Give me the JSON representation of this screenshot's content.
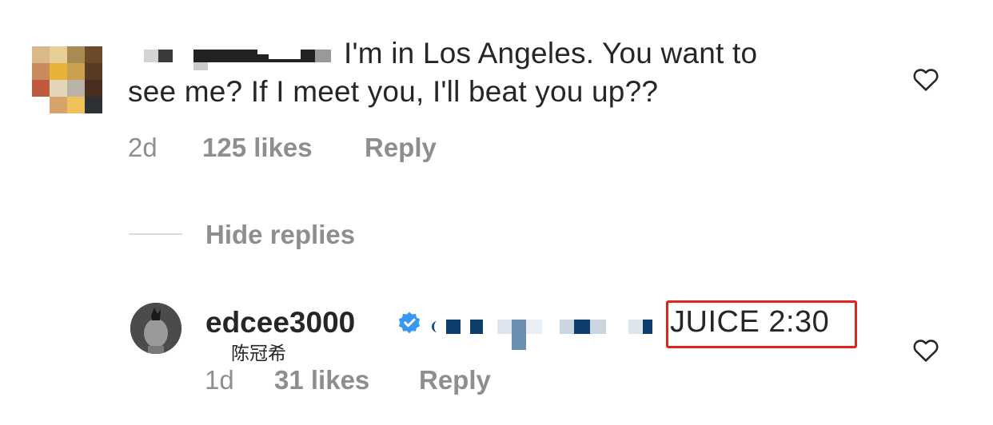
{
  "comment1": {
    "text_line1": "I'm in Los Angeles. You want to",
    "text_line2": "see me? If I meet you, I'll beat you up??",
    "time": "2d",
    "likes": "125 likes",
    "reply": "Reply"
  },
  "thread": {
    "hide_replies": "Hide replies"
  },
  "comment2": {
    "username": "edcee3000",
    "chinese_name": "陈冠希",
    "highlight_text": "JUICE 2:30",
    "time": "1d",
    "likes": "31 likes",
    "reply": "Reply"
  },
  "icons": {
    "like": "heart-outline-icon",
    "verified": "verified-badge-icon"
  },
  "colors": {
    "text": "#262626",
    "meta": "#8e8e8e",
    "verified": "#3897f0",
    "highlight_box": "#e0241b",
    "divider": "#dbdbdb"
  }
}
